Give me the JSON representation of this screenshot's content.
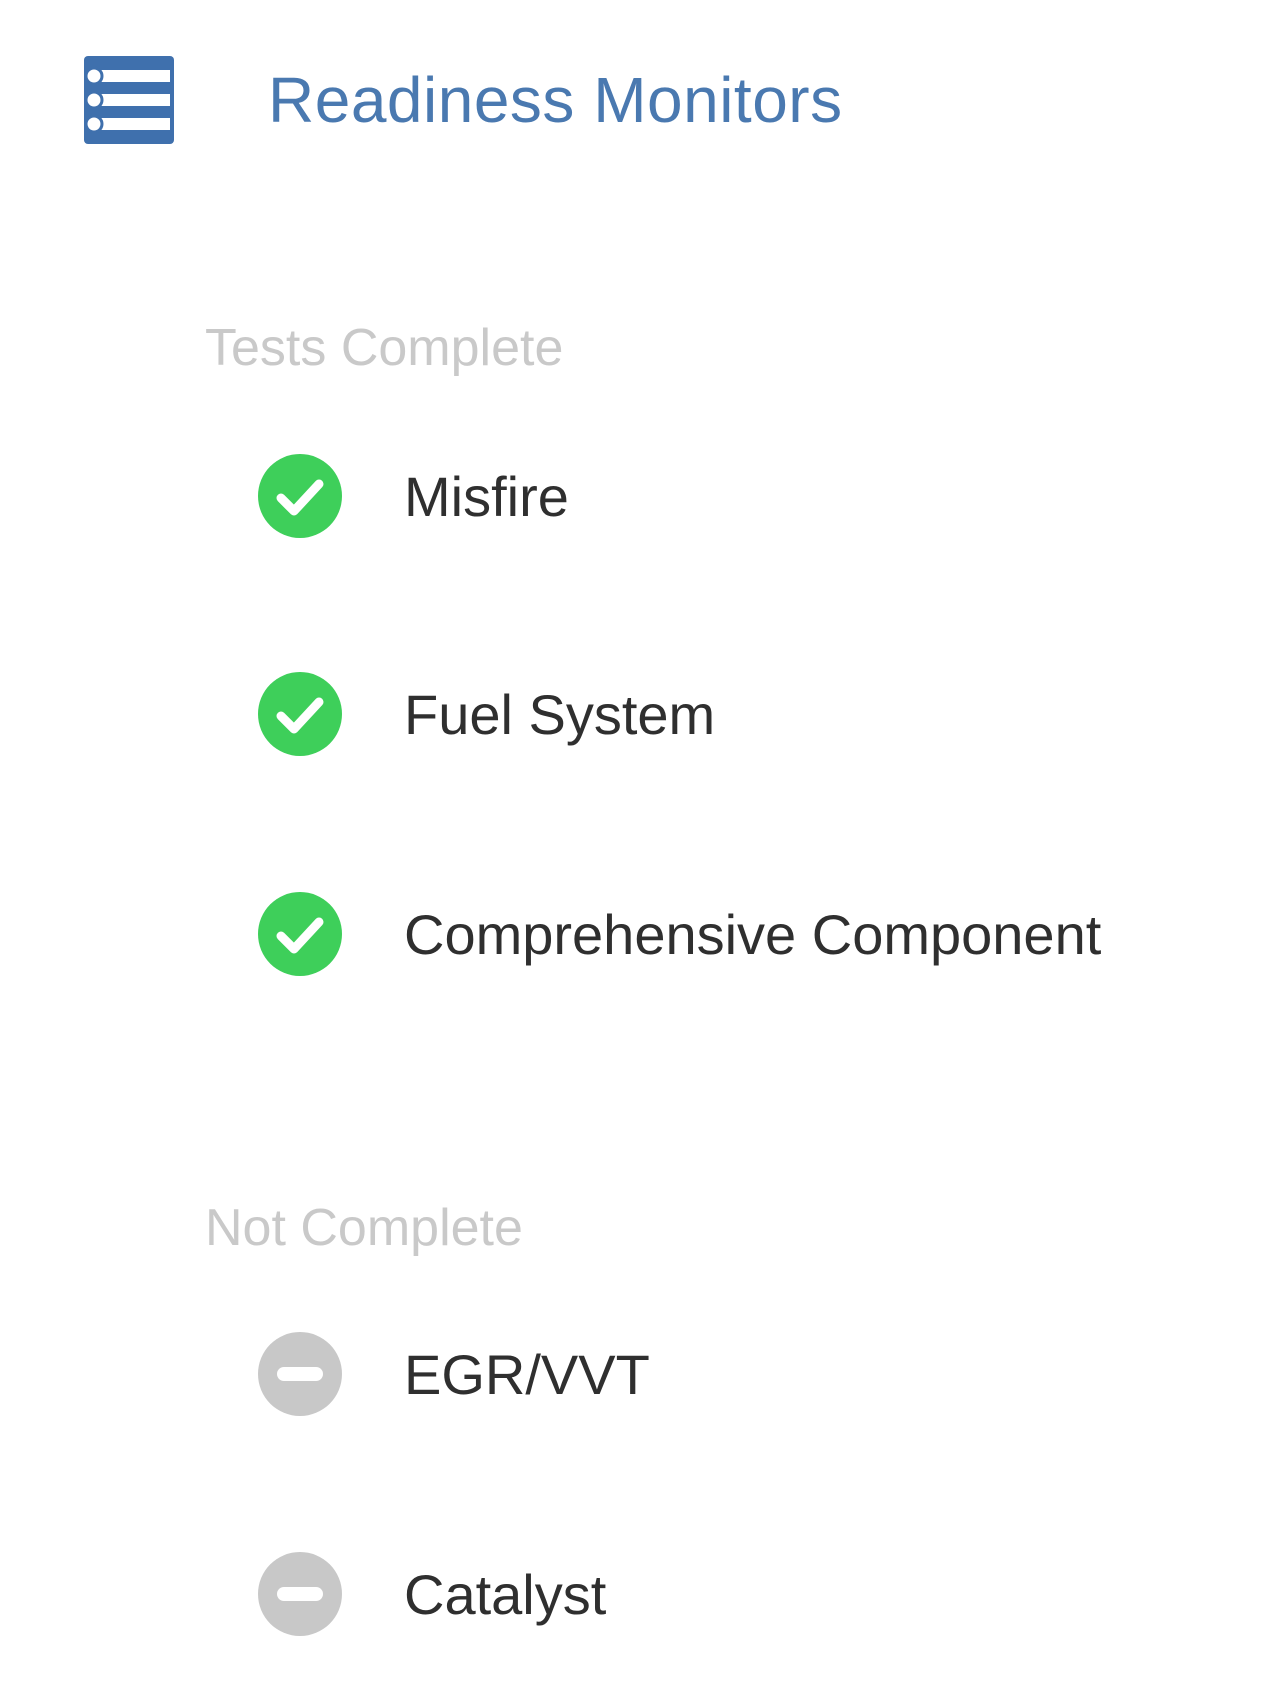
{
  "header": {
    "title": "Readiness Monitors",
    "icon": "list-icon",
    "color": "#4a79b0"
  },
  "sections": [
    {
      "label": "Tests Complete",
      "status": "complete",
      "status_icon": "check-circle-icon",
      "status_color": "#3ecf5a",
      "items": [
        {
          "label": "Misfire"
        },
        {
          "label": "Fuel System"
        },
        {
          "label": "Comprehensive Component"
        }
      ]
    },
    {
      "label": "Not Complete",
      "status": "not-complete",
      "status_icon": "minus-circle-icon",
      "status_color": "#c8c8c8",
      "items": [
        {
          "label": "EGR/VVT"
        },
        {
          "label": "Catalyst"
        }
      ]
    }
  ]
}
